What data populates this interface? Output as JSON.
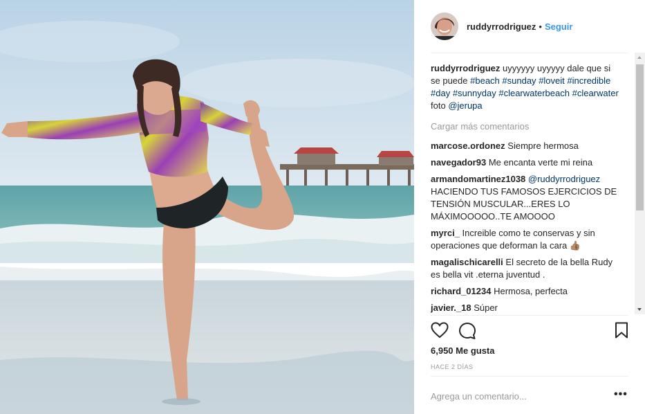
{
  "post": {
    "image_alt": "Woman in patterned swim top balancing on one leg at the beach"
  },
  "header": {
    "username": "ruddyrrodriguez",
    "separator": "•",
    "follow_label": "Seguir"
  },
  "caption": {
    "username": "ruddyrrodriguez",
    "text": "uyyyyyy uyyyyy dale que si se puede",
    "hashtags": [
      "#beach",
      "#sunday",
      "#loveit",
      "#incredible",
      "#day",
      "#sunnyday",
      "#clearwaterbeach",
      "#clearwater"
    ],
    "credit_text": "foto",
    "mention": "@jerupa"
  },
  "load_more_label": "Cargar más comentarios",
  "comments": [
    {
      "username": "marcose.ordonez",
      "mention": "",
      "text": "Siempre hermosa"
    },
    {
      "username": "navegador93",
      "mention": "",
      "text": "Me encanta verte mi reina"
    },
    {
      "username": "armandomartinez1038",
      "mention": "@ruddyrrodriguez",
      "text": "HACIENDO TUS FAMOSOS EJERCICIOS DE TENSIÓN MUSCULAR...ERES LO MÁXIMOOOOO..TE AMOOOO"
    },
    {
      "username": "myrci_",
      "mention": "",
      "text": "Increible como te conservas y sin operaciones que deforman la cara 👍🏽"
    },
    {
      "username": "magalischicarelli",
      "mention": "",
      "text": "El secreto de la bella Rudy es bella vit .eterna juventud ."
    },
    {
      "username": "richard_01234",
      "mention": "",
      "text": "Hermosa, perfecta"
    },
    {
      "username": "javier._18",
      "mention": "",
      "text": "Súper"
    }
  ],
  "actions": {
    "like_icon": "heart-icon",
    "comment_icon": "comment-bubble-icon",
    "save_icon": "bookmark-icon"
  },
  "likes_label": "6,950 Me gusta",
  "time_label": "HACE 2 DÍAS",
  "add_comment": {
    "placeholder": "Agrega un comentario..."
  },
  "more_options_label": "•••",
  "colors": {
    "link": "#003569",
    "follow": "#3897f0",
    "muted": "#999999",
    "divider": "#efefef"
  }
}
